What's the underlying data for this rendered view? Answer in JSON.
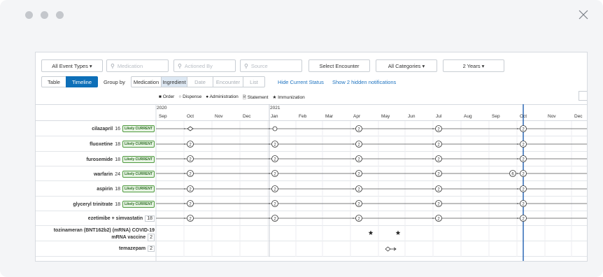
{
  "toolbar": {
    "event_types": "All Event Types ▾",
    "medication_placeholder": "Medication",
    "actioned_by_placeholder": "Actioned By",
    "source_placeholder": "Source",
    "select_encounter": "Select Encounter",
    "all_categories": "All Categories ▾",
    "period": "2 Years ▾"
  },
  "view": {
    "table": "Table",
    "timeline": "Timeline",
    "group_by": "Group by",
    "group_options": [
      "Medication",
      "Ingredient",
      "Date",
      "Encounter",
      "List"
    ],
    "hide_status": "Hide Current Status",
    "show_hidden": "Show 2 hidden notifications"
  },
  "legend": [
    "■ Order",
    "○ Dispense",
    "● Administration",
    "🗎 Statement",
    "★ Immunization"
  ],
  "timeline": {
    "years": [
      "2020",
      "2021"
    ],
    "months": [
      "Sep",
      "Oct",
      "Nov",
      "Dec",
      "Jan",
      "Feb",
      "Mar",
      "Apr",
      "May",
      "Jun",
      "Jul",
      "Aug",
      "Sep",
      "Oct",
      "Nov",
      "Dec"
    ]
  },
  "rows": [
    {
      "name": "cilazapril",
      "count": "16",
      "badge": "Likely CURRENT"
    },
    {
      "name": "fluoxetine",
      "count": "18",
      "badge": "Likely CURRENT"
    },
    {
      "name": "furosemide",
      "count": "18",
      "badge": "Likely CURRENT"
    },
    {
      "name": "warfarin",
      "count": "24",
      "badge": "Likely CURRENT"
    },
    {
      "name": "aspirin",
      "count": "18",
      "badge": "Likely CURRENT"
    },
    {
      "name": "glyceryl trinitrate",
      "count": "18",
      "badge": "Likely CURRENT"
    },
    {
      "name": "ezetimibe + simvastatin",
      "count": "18",
      "badge": ""
    },
    {
      "name_line1": "tozinameran (BNT162b2) (mRNA) COVID-19",
      "name_line2": "mRNA vaccine",
      "count": "2",
      "badge": ""
    },
    {
      "name": "temazepam",
      "count": "2",
      "badge": ""
    }
  ],
  "markers": {
    "default_count": "2",
    "warfarin_extra": "6"
  },
  "colors": {
    "primary": "#0d6fb8",
    "current_line": "#1f5fb0",
    "badge_green": "#4e9a3f"
  }
}
